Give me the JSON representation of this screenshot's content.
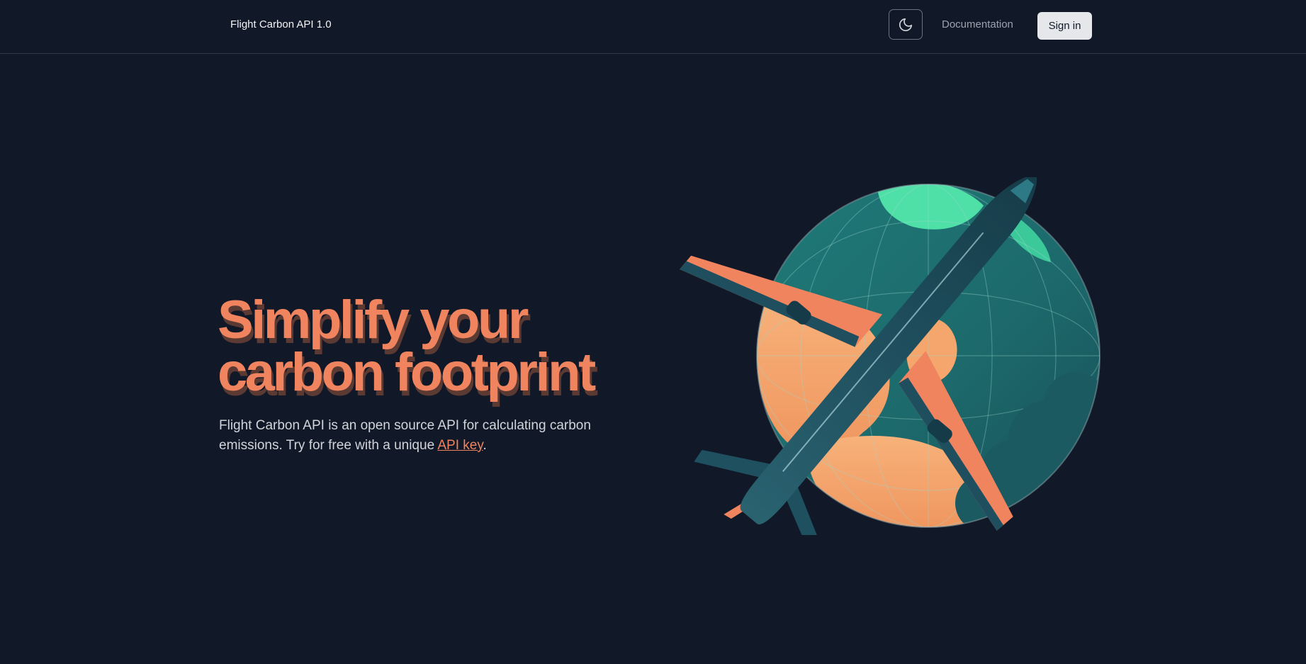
{
  "nav": {
    "brand": "Flight Carbon API 1.0",
    "theme_icon": "moon-icon",
    "docs_label": "Documentation",
    "signin_label": "Sign in"
  },
  "hero": {
    "title_line1": "Simplify your",
    "title_line2": "carbon footprint",
    "text_before": "Flight Carbon API is an open source API for calculating carbon emissions. Try for free with a unique ",
    "link_label": "API key",
    "text_after": "."
  },
  "illustration": {
    "name": "plane-globe-illustration"
  },
  "colors": {
    "background": "#111827",
    "accent": "#f0845f",
    "text": "#d1d5db",
    "teal": "#1f6b6e",
    "mint": "#4fe0a8"
  }
}
